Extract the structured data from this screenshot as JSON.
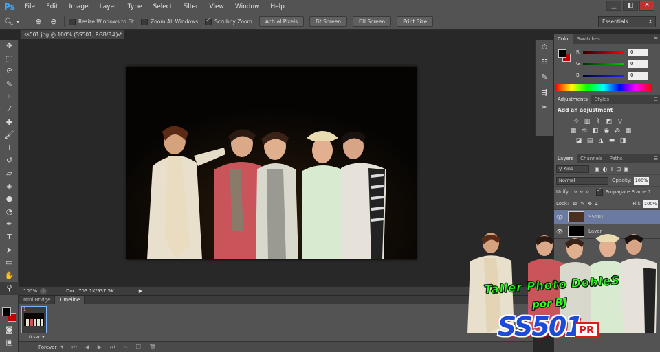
{
  "app": {
    "logo": "Ps"
  },
  "menu": [
    "File",
    "Edit",
    "Image",
    "Layer",
    "Type",
    "Select",
    "Filter",
    "View",
    "Window",
    "Help"
  ],
  "window_controls": [
    "▁",
    "◧",
    "✕"
  ],
  "options": {
    "resize_windows": "Resize Windows to Fit",
    "zoom_all": "Zoom All Windows",
    "scrubby_zoom": "Scrubby Zoom",
    "buttons": [
      "Actual Pixels",
      "Fit Screen",
      "Fill Screen",
      "Print Size"
    ],
    "workspace": "Essentials"
  },
  "document": {
    "tab_title": "ss501.jpg @ 100% (SS501, RGB/8#) *",
    "close": "×"
  },
  "status": {
    "zoom": "100%",
    "doc_info": "Doc: 703.1K/937.5K"
  },
  "bottom_tabs": [
    "Mini Bridge",
    "Timeline"
  ],
  "timeline": {
    "frame_number": "1",
    "frame_delay": "0 sec.▾",
    "loop": "Forever"
  },
  "color_panel": {
    "tabs": [
      "Color",
      "Swatches"
    ],
    "channels": [
      {
        "label": "R",
        "value": "0",
        "color": "#d01010"
      },
      {
        "label": "G",
        "value": "0",
        "color": "#10b010"
      },
      {
        "label": "B",
        "value": "0",
        "color": "#1030d0"
      }
    ]
  },
  "adjustments": {
    "tabs": [
      "Adjustments",
      "Styles"
    ],
    "title": "Add an adjustment"
  },
  "layers": {
    "tabs": [
      "Layers",
      "Channels",
      "Paths"
    ],
    "kind": "Kind",
    "blend_mode": "Normal",
    "opacity_label": "Opacity:",
    "opacity": "100%",
    "unify_label": "Unify:",
    "propagate": "Propagate Frame 1",
    "lock_label": "Lock:",
    "fill_label": "Fill:",
    "fill": "100%",
    "items": [
      {
        "name": "SS501",
        "selected": true
      },
      {
        "name": "Layer",
        "selected": false
      }
    ]
  },
  "watermark": {
    "title": "Taller Photo DobleS",
    "subtitle": "por BJ",
    "logo": "SS501",
    "badge": "PR"
  }
}
